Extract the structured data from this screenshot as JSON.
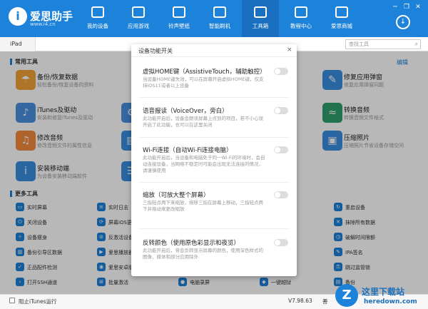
{
  "window": {
    "min": "─",
    "restore": "❐",
    "close": "✕"
  },
  "brand": {
    "name": "爱思助手",
    "url": "www.i4.cn"
  },
  "nav": [
    {
      "label": "我的设备"
    },
    {
      "label": "应用游戏"
    },
    {
      "label": "铃声壁纸"
    },
    {
      "label": "智能刷机"
    },
    {
      "label": "工具箱",
      "active": true
    },
    {
      "label": "教程中心"
    },
    {
      "label": "爱思商城"
    }
  ],
  "device_tab": "iPad",
  "search": {
    "placeholder": "查找工具"
  },
  "common": {
    "title": "常用工具",
    "edit": "编辑",
    "left": [
      {
        "title": "备份/恢复数据",
        "desc": "轻松备份/恢复设备的资料",
        "color": "#f2a33a",
        "icon": "umbrella-icon"
      },
      {
        "title": "iTunes及驱动",
        "desc": "安装和修复iTunes及驱动",
        "color": "#4a8fe0",
        "icon": "music-icon"
      },
      {
        "title": "修改音频",
        "desc": "修改音频文件的属性信息",
        "color": "#f08a3a",
        "icon": "note-icon"
      },
      {
        "title": "安装移动端",
        "desc": "为设备安装移动端软件",
        "color": "#3a8ee0",
        "icon": "app-icon"
      }
    ],
    "right": [
      {
        "title": "修复应用弹窗",
        "desc": "修复应用弹窗问题",
        "color": "#3a8ee0",
        "icon": "wrench-icon"
      },
      {
        "title": "转换音频",
        "desc": "转换音频文件格式",
        "color": "#2e9e6e",
        "icon": "wave-icon"
      },
      {
        "title": "压缩照片",
        "desc": "压缩照片节省设备存储空间",
        "color": "#3a8ee0",
        "icon": "photo-icon"
      }
    ]
  },
  "more": {
    "title": "更多工具",
    "col1": [
      "实时屏幕",
      "关闭设备",
      "设备瘦身",
      "备份引导区数据",
      "正品配件检测",
      "打开SSH通道"
    ],
    "col2": [
      "实时日志",
      "屏幕iOS更新",
      "反激活设备",
      "爱思播放器",
      "爱思安卓版",
      "批量激活"
    ],
    "col3_mid": [
      "电脑录屏",
      "一键越狱"
    ],
    "col4": [
      "重启设备",
      "抹除所有数据",
      "破解时间限额",
      "IPA签名",
      "跳过监管锁",
      "备份"
    ]
  },
  "footer": {
    "itunes_label": "阻止iTunes运行",
    "version": "V7.98.63",
    "extra": "善"
  },
  "dialog": {
    "title": "设备功能开关",
    "close": "×",
    "options": [
      {
        "title": "虚拟HOME键（AssistiveTouch，辅助触控）",
        "desc": "当设备HOME键失效，可以在屏幕开启虚拟HOME键，仅支持iOS11或者以上设备"
      },
      {
        "title": "语音报读（VoiceOver，旁白）",
        "desc": "此功能开启后，设备会朗读屏幕上点到的项目，若不小心误开启了此功能，也可以在这里关闭"
      },
      {
        "title": "Wi-Fi连接（自动Wi-Fi连接电脑）",
        "desc": "此功能开启后，当设备和电脑处于同一Wi-Fi的环境时，会自动连接设备，当网络不稳定时可能会出现无法连接的情况，请谨慎使用"
      },
      {
        "title": "缩放（可放大整个屏幕）",
        "desc": "三指轻点两下来缩放，拖移三指在屏幕上移动，三指轻点两下并拖动来更改缩放"
      },
      {
        "title": "反转颜色（使用原色彩显示和夜览）",
        "desc": "此功能开启后，将会反转显示屏幕的颜色，使用深色样式的图像，媒体和部分应用除外"
      }
    ]
  },
  "watermark": {
    "logo": "Z",
    "text": "这里下载站",
    "url": "heredown.com"
  }
}
